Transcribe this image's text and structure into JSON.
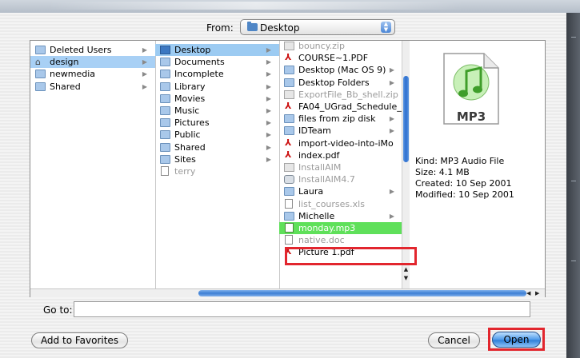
{
  "from": {
    "label": "From:",
    "location": "Desktop"
  },
  "columns": [
    {
      "items": [
        {
          "label": "Deleted Users",
          "icon": "folder-icon",
          "arrow": true
        },
        {
          "label": "design",
          "icon": "home-icon",
          "arrow": true,
          "selected": true
        },
        {
          "label": "newmedia",
          "icon": "folder-icon",
          "arrow": true
        },
        {
          "label": "Shared",
          "icon": "folder-icon",
          "arrow": true
        }
      ]
    },
    {
      "items": [
        {
          "label": "Desktop",
          "icon": "desktop-folder-icon",
          "arrow": true,
          "selected": true
        },
        {
          "label": "Documents",
          "icon": "folder-icon",
          "arrow": true
        },
        {
          "label": "Incomplete",
          "icon": "folder-icon",
          "arrow": true
        },
        {
          "label": "Library",
          "icon": "library-folder-icon",
          "arrow": true
        },
        {
          "label": "Movies",
          "icon": "movies-folder-icon",
          "arrow": true
        },
        {
          "label": "Music",
          "icon": "music-folder-icon",
          "arrow": true
        },
        {
          "label": "Pictures",
          "icon": "pictures-folder-icon",
          "arrow": true
        },
        {
          "label": "Public",
          "icon": "public-folder-icon",
          "arrow": true
        },
        {
          "label": "Shared",
          "icon": "folder-icon",
          "arrow": true
        },
        {
          "label": "Sites",
          "icon": "sites-folder-icon",
          "arrow": true
        },
        {
          "label": "terry",
          "icon": "document-icon",
          "arrow": false,
          "disabled": true
        }
      ]
    },
    {
      "items": [
        {
          "label": "bouncy.zip",
          "icon": "zip-icon",
          "disabled": true
        },
        {
          "label": "COURSE~1.PDF",
          "icon": "pdf-icon"
        },
        {
          "label": "Desktop (Mac OS 9)",
          "icon": "folder-icon",
          "arrow": true
        },
        {
          "label": "Desktop Folders",
          "icon": "apple-folder-icon",
          "arrow": true
        },
        {
          "label": "ExportFile_Bb_shell.zip",
          "icon": "zip-icon",
          "disabled": true
        },
        {
          "label": "FA04_UGrad_Schedule_",
          "icon": "pdf-icon"
        },
        {
          "label": "files from zip disk",
          "icon": "folder-icon",
          "arrow": true
        },
        {
          "label": "IDTeam",
          "icon": "folder-icon",
          "arrow": true
        },
        {
          "label": "import-video-into-iMo",
          "icon": "pdf-icon"
        },
        {
          "label": "index.pdf",
          "icon": "pdf-icon"
        },
        {
          "label": "InstallAIM",
          "icon": "zip-icon",
          "disabled": true
        },
        {
          "label": "InstallAIM4.7",
          "icon": "app-icon",
          "disabled": true
        },
        {
          "label": "Laura",
          "icon": "folder-icon",
          "arrow": true
        },
        {
          "label": "list_courses.xls",
          "icon": "document-icon",
          "disabled": true
        },
        {
          "label": "Michelle",
          "icon": "folder-icon",
          "arrow": true
        },
        {
          "label": "monday.mp3",
          "icon": "mp3-icon",
          "highlighted": true
        },
        {
          "label": "native.doc",
          "icon": "document-icon",
          "disabled": true
        },
        {
          "label": "Picture 1.pdf",
          "icon": "pdf-icon"
        }
      ]
    }
  ],
  "preview": {
    "icon_label": "MP3",
    "kind": "Kind: MP3 Audio File",
    "size": "Size: 4.1 MB",
    "created": "Created: 10 Sep 2001",
    "modified": "Modified: 10 Sep 2001"
  },
  "goto": {
    "label": "Go to:",
    "value": ""
  },
  "buttons": {
    "add_favorites": "Add to Favorites",
    "cancel": "Cancel",
    "open": "Open"
  },
  "colors": {
    "selection": "#9ccbf2",
    "highlight": "#5fe05a",
    "annotation_red": "#e2262e",
    "accent_blue": "#2f7fd8"
  }
}
